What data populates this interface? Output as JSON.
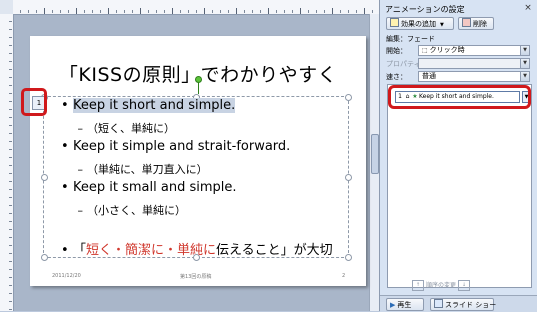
{
  "slide": {
    "title": "「KISSの原則」でわかりやすく",
    "bullets": [
      {
        "level": 1,
        "text": "Keep it short and simple.",
        "highlighted": true
      },
      {
        "level": 2,
        "text": "（短く、単純に）"
      },
      {
        "level": 1,
        "text": "Keep it simple and strait-forward."
      },
      {
        "level": 2,
        "text": "（単純に、単刀直入に）"
      },
      {
        "level": 1,
        "text": "Keep it small and simple."
      },
      {
        "level": 2,
        "text": "（小さく、単純に）"
      }
    ],
    "conclusion": {
      "prefix": "「",
      "red_text": "短く・簡潔に・単純に",
      "suffix": "伝えること」が大切"
    },
    "animation_marker": "1",
    "footer": {
      "date": "2011/12/20",
      "center": "第13回の原稿",
      "page": "2"
    }
  },
  "pane": {
    "title": "アニメーションの設定",
    "close": "×",
    "add_effect_label": "効果の追加",
    "delete_label": "削除",
    "edit_label": "編集：フェード",
    "start_label": "開始：",
    "start_value": "クリック時",
    "property_label": "プロパティ",
    "speed_label": "速さ：",
    "speed_value": "普通",
    "list_item": {
      "num": "1",
      "text": "Keep it short and simple."
    },
    "reorder_label": "順序の変更",
    "play_label": "再生",
    "slideshow_label": "スライド ショー"
  },
  "colors": {
    "accent_red": "#d0372c",
    "callout_outline": "#d0191c",
    "pane_bg": "#d7e3f3"
  }
}
